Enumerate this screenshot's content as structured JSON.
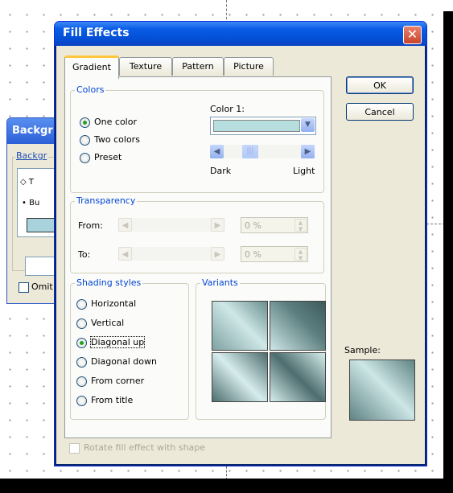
{
  "background_dialog": {
    "title": "Backgr",
    "group_label": "Backgr",
    "preview_line1": "T",
    "preview_line2": "Bu",
    "omit_label": "Omit"
  },
  "dialog": {
    "title": "Fill Effects",
    "close_glyph": "✕",
    "tabs": [
      "Gradient",
      "Texture",
      "Pattern",
      "Picture"
    ],
    "active_tab": "Gradient",
    "ok_label": "OK",
    "cancel_label": "Cancel",
    "sample_label": "Sample:",
    "rotate_label": "Rotate fill effect with shape",
    "rotate_checked": false
  },
  "colors": {
    "group_label": "Colors",
    "options": [
      {
        "label": "One color",
        "checked": true
      },
      {
        "label": "Two colors",
        "checked": false
      },
      {
        "label": "Preset",
        "checked": false
      }
    ],
    "color1_label": "Color 1:",
    "color1_swatch": "#b6dede",
    "dark_label": "Dark",
    "light_label": "Light",
    "slider_position_fraction": 0.3
  },
  "transparency": {
    "group_label": "Transparency",
    "from_label": "From:",
    "to_label": "To:",
    "from_value": "0 %",
    "to_value": "0 %"
  },
  "shading": {
    "group_label": "Shading styles",
    "options": [
      {
        "label": "Horizontal",
        "checked": false
      },
      {
        "label": "Vertical",
        "checked": false
      },
      {
        "label": "Diagonal up",
        "checked": true
      },
      {
        "label": "Diagonal down",
        "checked": false
      },
      {
        "label": "From corner",
        "checked": false
      },
      {
        "label": "From title",
        "checked": false
      }
    ]
  },
  "variants": {
    "group_label": "Variants"
  },
  "theme": {
    "title_bar": "#0a5ce6",
    "dialog_face": "#ece9d8",
    "group_label": "#0046d5",
    "close_button": "#d95535"
  }
}
